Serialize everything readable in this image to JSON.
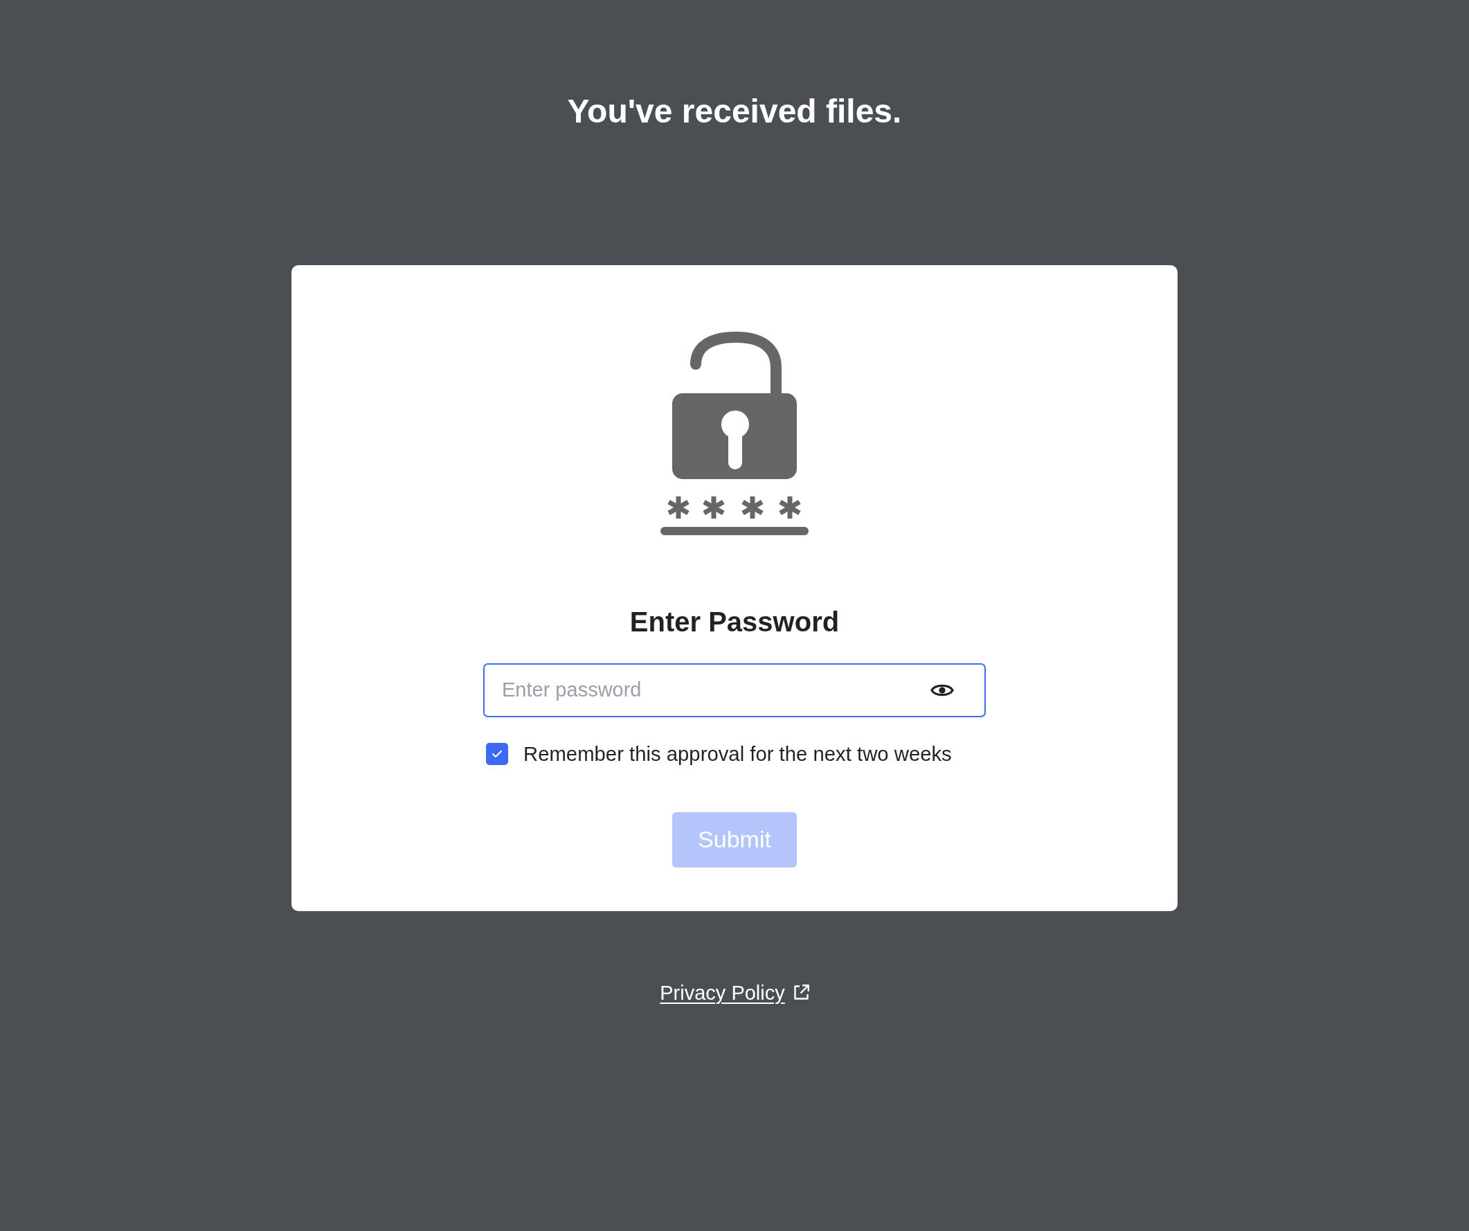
{
  "page": {
    "title": "You've received files."
  },
  "card": {
    "heading": "Enter Password",
    "password_field": {
      "placeholder": "Enter password",
      "focused": true
    },
    "remember": {
      "label": "Remember this approval for the next two weeks",
      "checked": true
    },
    "submit": {
      "label": "Submit",
      "disabled": true
    }
  },
  "footer": {
    "privacy_link": "Privacy Policy"
  }
}
